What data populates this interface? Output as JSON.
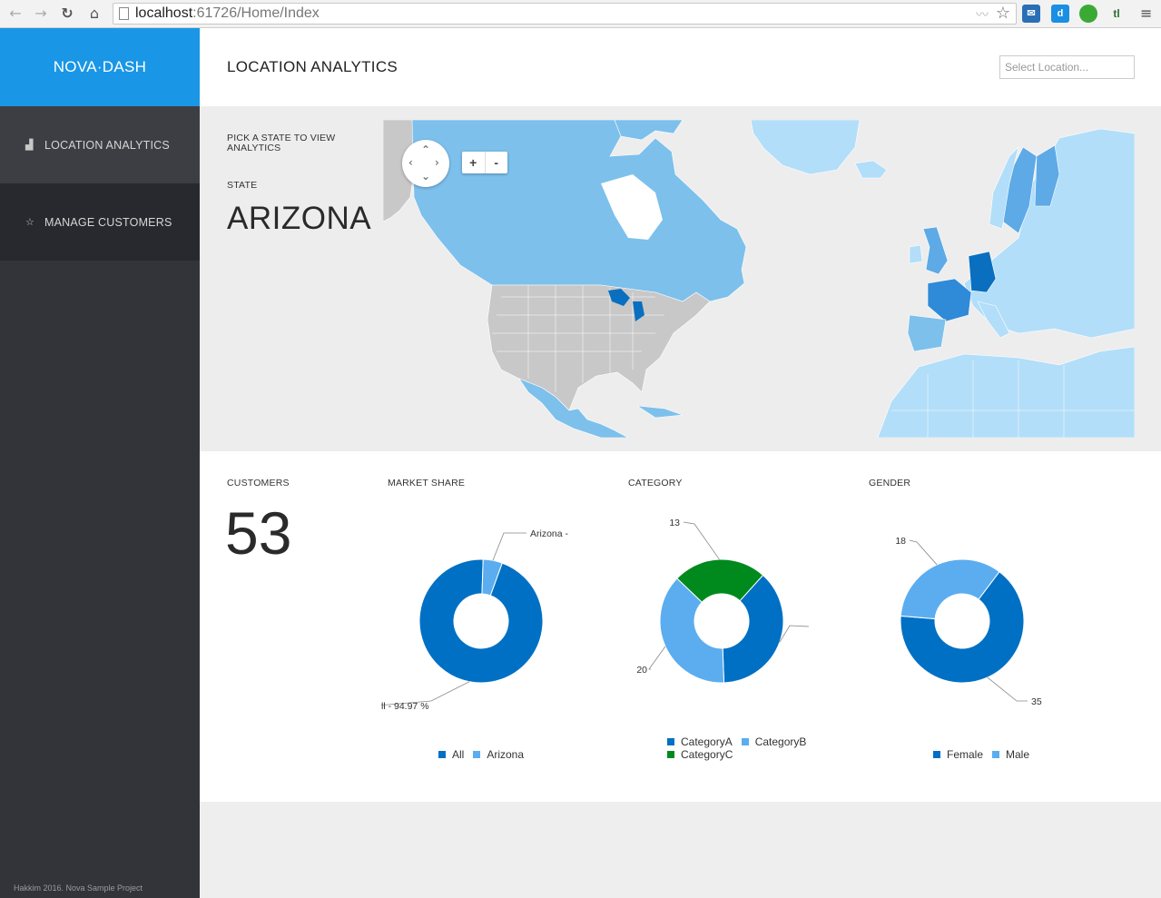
{
  "browser": {
    "url_host": "localhost",
    "url_rest": ":61726/Home/Index"
  },
  "sidebar": {
    "brand": "NOVA·DASH",
    "items": [
      {
        "label": "LOCATION ANALYTICS",
        "icon": "bar-chart-icon"
      },
      {
        "label": "MANAGE CUSTOMERS",
        "icon": "star-icon"
      }
    ],
    "footer": "Hakkim 2016. Nova Sample Project"
  },
  "header": {
    "title": "LOCATION ANALYTICS",
    "location_placeholder": "Select Location..."
  },
  "map_panel": {
    "pick_text": "PICK A STATE TO VIEW ANALYTICS",
    "state_label": "STATE",
    "state_value": "ARIZONA",
    "zoom_in": "+",
    "zoom_out": "-"
  },
  "stats": {
    "customers_label": "CUSTOMERS",
    "customers_value": "53",
    "market_label": "MARKET SHARE",
    "category_label": "CATEGORY",
    "gender_label": "GENDER"
  },
  "chart_data": [
    {
      "type": "pie",
      "title": "MARKET SHARE",
      "categories": [
        "All",
        "Arizona"
      ],
      "values": [
        94.97,
        5.03
      ],
      "colors": [
        "#0070c4",
        "#5badf0"
      ],
      "data_labels": [
        "ll - 94.97 %",
        "Arizona -"
      ]
    },
    {
      "type": "pie",
      "title": "CATEGORY",
      "categories": [
        "CategoryA",
        "CategoryB",
        "CategoryC"
      ],
      "values": [
        20,
        20,
        13
      ],
      "colors": [
        "#0070c4",
        "#5badf0",
        "#008a1e"
      ],
      "data_labels": [
        "",
        "20",
        "13"
      ]
    },
    {
      "type": "pie",
      "title": "GENDER",
      "categories": [
        "Female",
        "Male"
      ],
      "values": [
        35,
        18
      ],
      "colors": [
        "#0070c4",
        "#5badf0"
      ],
      "data_labels": [
        "35",
        "18"
      ]
    }
  ],
  "colors": {
    "brand": "#1a96e6",
    "sidebar": "#333439",
    "series_dark": "#0070c4",
    "series_light": "#5badf0",
    "series_green": "#008a1e"
  }
}
